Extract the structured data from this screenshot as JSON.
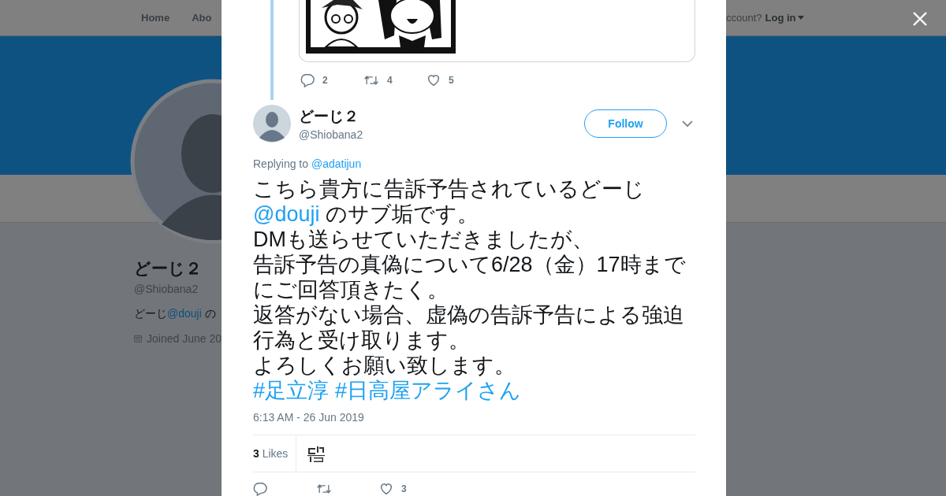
{
  "background": {
    "nav": {
      "items": [
        "Home",
        "Abo"
      ],
      "account_prompt": "ccount?",
      "login": "Log in"
    },
    "profile": {
      "name": "どーじ２",
      "handle": "@Shiobana2",
      "bio": [
        {
          "kind": "text",
          "text": "どーじ"
        },
        {
          "kind": "mention",
          "text": "@douji"
        },
        {
          "kind": "text",
          "text": " の"
        }
      ],
      "joined": "Joined June 20"
    }
  },
  "modal": {
    "parent_tweet": {
      "actions": [
        {
          "kind": "reply",
          "count": "2"
        },
        {
          "kind": "retweet",
          "count": "4"
        },
        {
          "kind": "like",
          "count": "5"
        }
      ]
    },
    "tweet": {
      "name": "どーじ２",
      "handle": "@Shiobana2",
      "follow": "Follow",
      "replying_label": "Replying to",
      "replying_to": "@adatijun",
      "lines": [
        [
          {
            "kind": "text",
            "text": "こちら貴方に告訴予告されているどーじ"
          }
        ],
        [
          {
            "kind": "mention",
            "text": "@douji"
          },
          {
            "kind": "text",
            "text": " のサブ垢です。"
          }
        ],
        [
          {
            "kind": "text",
            "text": "DMも送らせていただきましたが、"
          }
        ],
        [
          {
            "kind": "text",
            "text": "告訴予告の真偽について6/28（金）17時まで"
          }
        ],
        [
          {
            "kind": "text",
            "text": "にご回答頂きたく。"
          }
        ],
        [
          {
            "kind": "text",
            "text": "返答がない場合、虚偽の告訴予告による強迫"
          }
        ],
        [
          {
            "kind": "text",
            "text": "行為と受け取ります。"
          }
        ],
        [
          {
            "kind": "text",
            "text": "よろしくお願い致します。"
          }
        ],
        [
          {
            "kind": "hashtag",
            "text": "#足立淳"
          },
          {
            "kind": "hashtag",
            "text": "#日高屋アライさん"
          }
        ]
      ],
      "time": "6:13 AM - 26 Jun 2019",
      "likes_count": "3",
      "likes_label": "Likes",
      "actions": [
        {
          "kind": "reply"
        },
        {
          "kind": "retweet"
        },
        {
          "kind": "like",
          "count": "3"
        }
      ]
    }
  }
}
